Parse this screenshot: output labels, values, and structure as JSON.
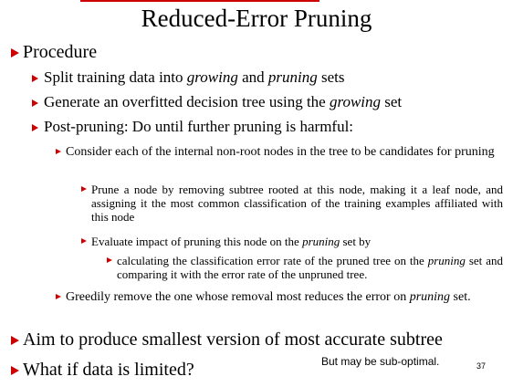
{
  "slide": {
    "title": "Reduced-Error Pruning",
    "procedure": "Procedure",
    "split": {
      "a": "Split training data into ",
      "b": "growing",
      "c": " and ",
      "d": "pruning",
      "e": " sets"
    },
    "generate": {
      "a": "Generate an overfitted decision tree using the ",
      "b": "growing",
      "c": " set"
    },
    "post": "Post-pruning:  Do until further pruning is harmful:",
    "consider": "Consider each of the internal non-root nodes in the tree to be candidates for pruning",
    "prune": "Prune a node by removing subtree rooted at this node, making it a leaf node, and assigning it the most common classification of the training examples affiliated with this node",
    "evaluate": {
      "a": "Evaluate impact of pruning this node on the ",
      "b": "pruning",
      "c": " set by"
    },
    "calc": {
      "a": "calculating the classification error rate of the pruned tree on the ",
      "b": "pruning",
      "c": " set and comparing it with the error rate of the unpruned tree."
    },
    "greedy": {
      "a": "Greedily remove the one whose removal most reduces the error on ",
      "b": "pruning",
      "c": " set."
    },
    "aim": "Aim to produce smallest version of most accurate subtree",
    "limited": "What if data is limited?",
    "note": "But may be sub-optimal.",
    "page": "37"
  },
  "colors": {
    "bullet": "#cc0000",
    "accent_line": "#cc0000"
  }
}
